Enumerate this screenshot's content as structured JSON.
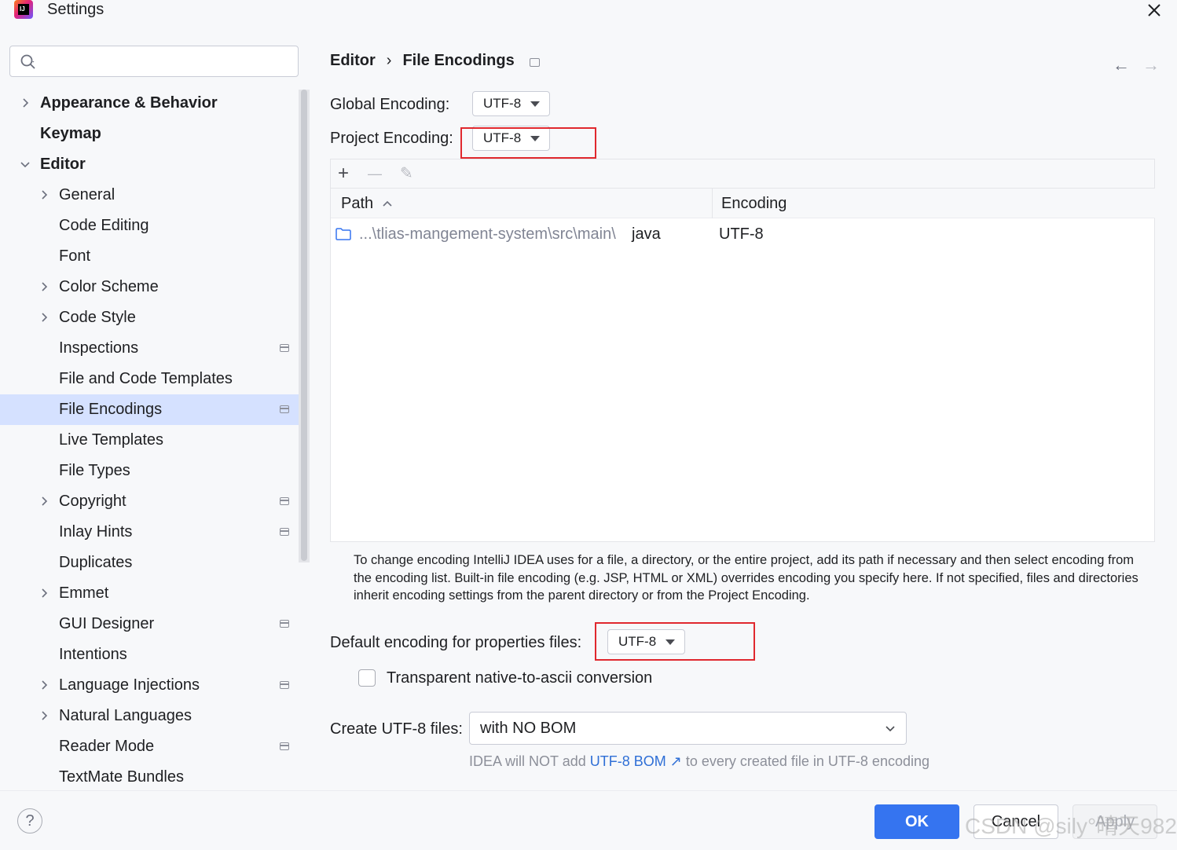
{
  "window": {
    "title": "Settings",
    "logo_text": "IJ"
  },
  "search": {
    "placeholder": "",
    "value": ""
  },
  "sidebar": {
    "items": [
      {
        "label": "Appearance & Behavior",
        "level": 0,
        "expandable": true,
        "expanded": false,
        "bold": true
      },
      {
        "label": "Keymap",
        "level": 0,
        "expandable": false,
        "bold": true
      },
      {
        "label": "Editor",
        "level": 0,
        "expandable": true,
        "expanded": true,
        "bold": true
      },
      {
        "label": "General",
        "level": 1,
        "expandable": true
      },
      {
        "label": "Code Editing",
        "level": 1
      },
      {
        "label": "Font",
        "level": 1
      },
      {
        "label": "Color Scheme",
        "level": 1,
        "expandable": true
      },
      {
        "label": "Code Style",
        "level": 1,
        "expandable": true
      },
      {
        "label": "Inspections",
        "level": 1,
        "project_icon": true
      },
      {
        "label": "File and Code Templates",
        "level": 1
      },
      {
        "label": "File Encodings",
        "level": 1,
        "project_icon": true,
        "selected": true
      },
      {
        "label": "Live Templates",
        "level": 1
      },
      {
        "label": "File Types",
        "level": 1
      },
      {
        "label": "Copyright",
        "level": 1,
        "expandable": true,
        "project_icon": true
      },
      {
        "label": "Inlay Hints",
        "level": 1,
        "project_icon": true
      },
      {
        "label": "Duplicates",
        "level": 1
      },
      {
        "label": "Emmet",
        "level": 1,
        "expandable": true
      },
      {
        "label": "GUI Designer",
        "level": 1,
        "project_icon": true
      },
      {
        "label": "Intentions",
        "level": 1
      },
      {
        "label": "Language Injections",
        "level": 1,
        "expandable": true,
        "project_icon": true
      },
      {
        "label": "Natural Languages",
        "level": 1,
        "expandable": true
      },
      {
        "label": "Reader Mode",
        "level": 1,
        "project_icon": true
      },
      {
        "label": "TextMate Bundles",
        "level": 1
      }
    ]
  },
  "breadcrumb": {
    "parent": "Editor",
    "separator": "›",
    "current": "File Encodings"
  },
  "nav": {
    "back": "←",
    "forward": "→"
  },
  "global_encoding": {
    "label": "Global Encoding:",
    "value": "UTF-8"
  },
  "project_encoding": {
    "label": "Project Encoding:",
    "value": "UTF-8"
  },
  "table_toolbar": {
    "add": "+",
    "remove": "—",
    "edit": "✎"
  },
  "table": {
    "columns": [
      "Path",
      "Encoding"
    ],
    "rows": [
      {
        "path_prefix": "...\\tlias-mangement-system\\src\\main\\",
        "path_leaf": "java",
        "encoding": "UTF-8"
      }
    ]
  },
  "info_text": "To change encoding IntelliJ IDEA uses for a file, a directory, or the entire project, add its path if necessary and then select encoding from the encoding list. Built-in file encoding (e.g. JSP, HTML or XML) overrides encoding you specify here. If not specified, files and directories inherit encoding settings from the parent directory or from the Project Encoding.",
  "properties_encoding": {
    "label": "Default encoding for properties files:",
    "value": "UTF-8"
  },
  "native_to_ascii": {
    "label": "Transparent native-to-ascii conversion",
    "checked": false
  },
  "create_utf8": {
    "label": "Create UTF-8 files:",
    "value": "with NO BOM"
  },
  "bom_hint": {
    "before": "IDEA will NOT add ",
    "link": "UTF-8 BOM",
    "link_arrow": "↗",
    "after": " to every created file in UTF-8 encoding"
  },
  "buttons": {
    "help": "?",
    "ok": "OK",
    "cancel": "Cancel",
    "apply": "Apply"
  },
  "watermark": "CSDN @sily°晴天982",
  "colors": {
    "accent": "#3574f0",
    "selected_row": "#d5e1ff",
    "highlight_box": "#e0282e",
    "link": "#2f6fd6"
  }
}
